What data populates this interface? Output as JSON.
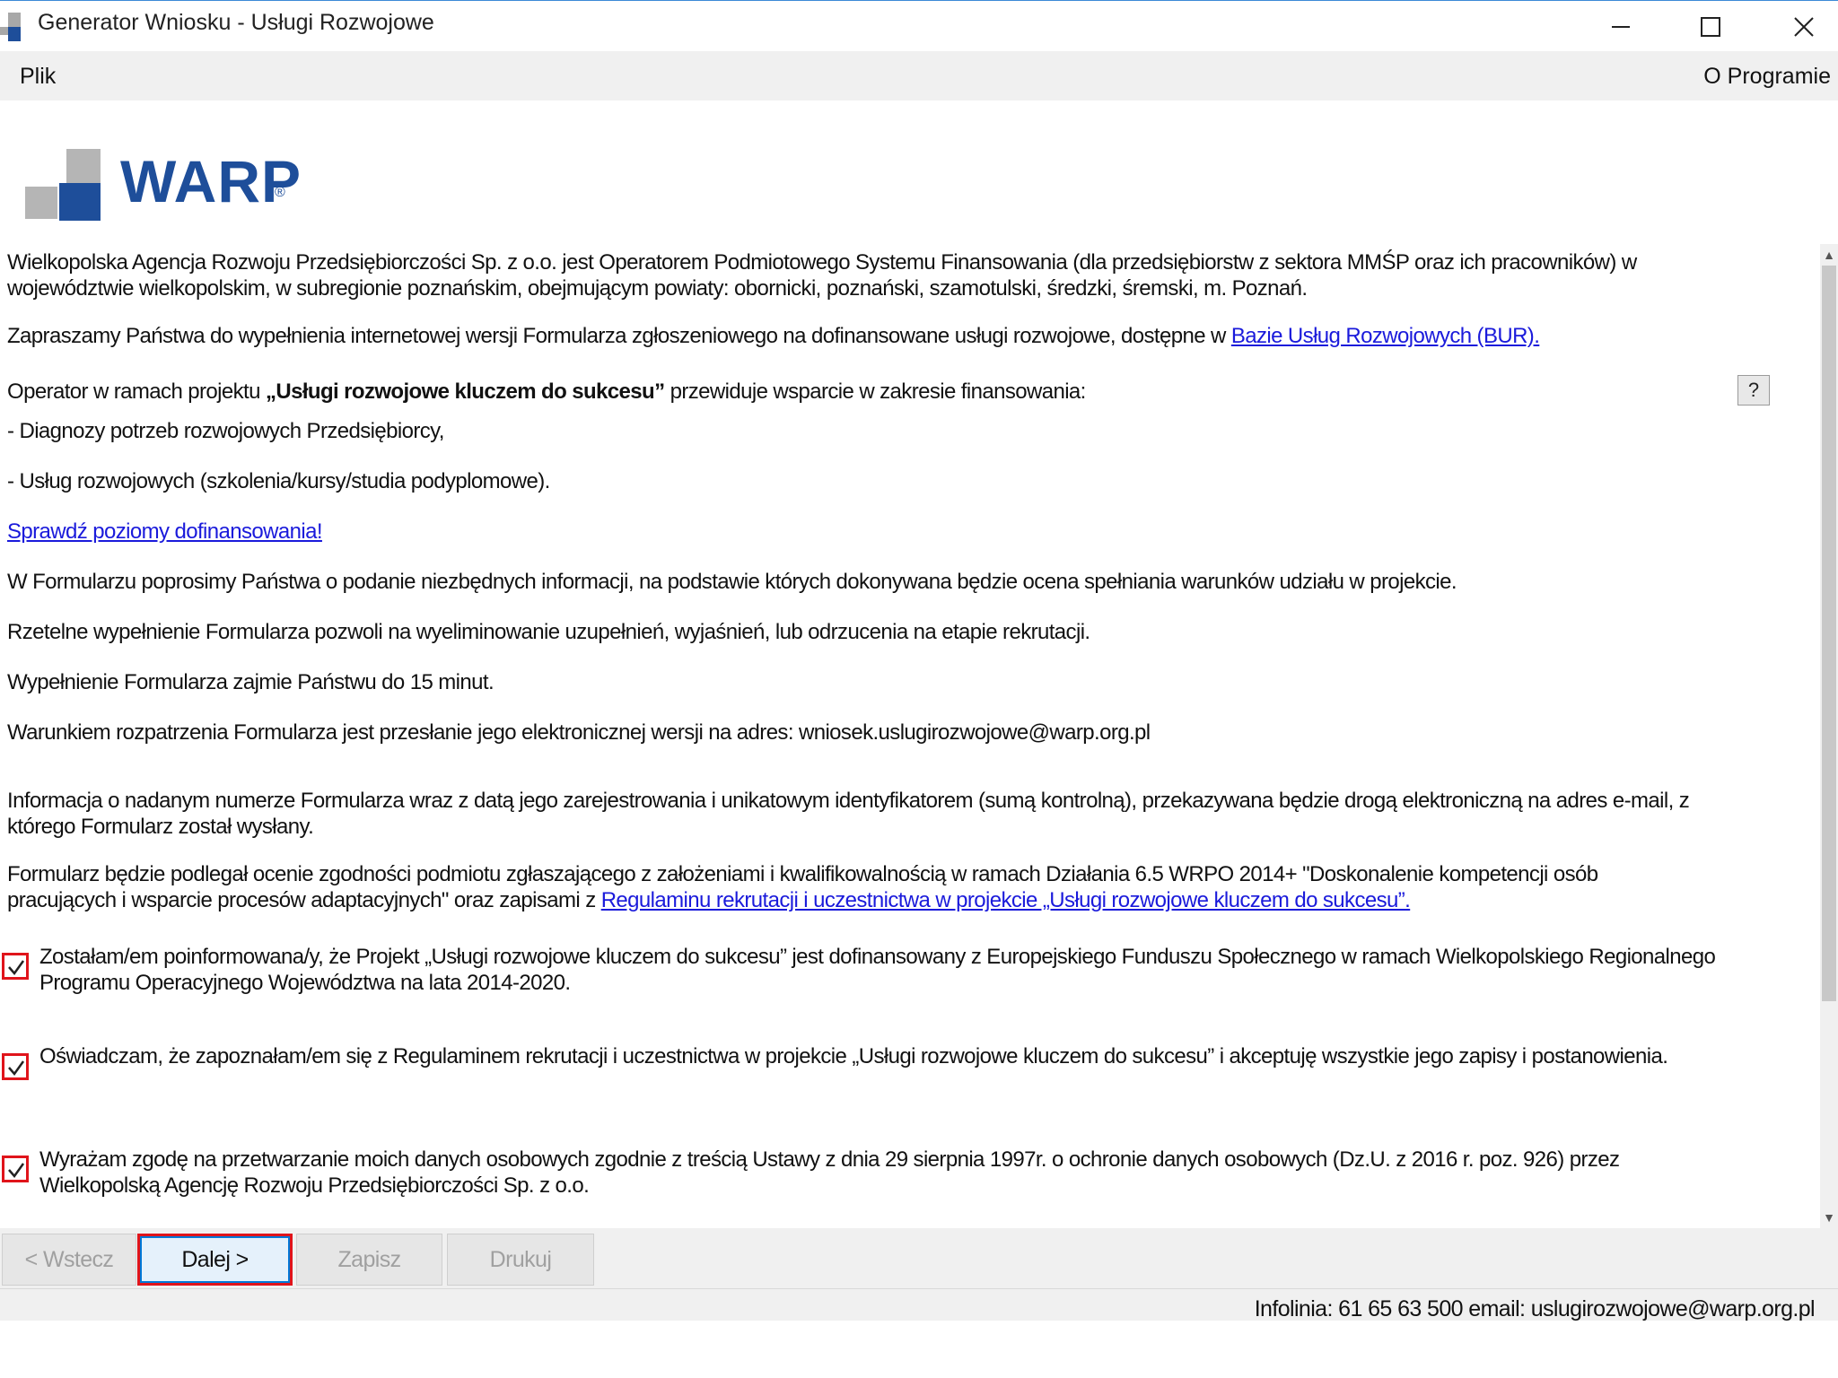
{
  "window": {
    "title": "Generator Wniosku - Usługi Rozwojowe"
  },
  "menu": {
    "file": "Plik",
    "about": "O Programie"
  },
  "logo": {
    "text": "WARP",
    "registered": "®"
  },
  "content": {
    "intro": "Wielkopolska Agencja Rozwoju Przedsiębiorczości Sp. z o.o. jest Operatorem Podmiotowego Systemu Finansowania (dla przedsiębiorstw z sektora MMŚP oraz ich pracowników) w województwie wielkopolskim, w subregionie poznańskim, obejmującym powiaty: obornicki, poznański, szamotulski, średzki, śremski, m. Poznań.",
    "invite_text": "Zapraszamy Państwa do wypełnienia internetowej wersji Formularza zgłoszeniowego na dofinansowane usługi rozwojowe, dostępne w ",
    "invite_link": "Bazie Usług Rozwojowych (BUR).",
    "operator_prefix": "Operator w ramach projektu ",
    "operator_project": "„Usługi rozwojowe kluczem do sukcesu”",
    "operator_suffix": " przewiduje wsparcie w zakresie finansowania:",
    "bullet_1": "- Diagnozy potrzeb rozwojowych Przedsiębiorcy,",
    "bullet_2": "- Usług rozwojowych (szkolenia/kursy/studia podyplomowe).",
    "check_levels_link": "Sprawdź poziomy dofinansowania!",
    "form_info": "W Formularzu poprosimy Państwa o podanie niezbędnych informacji, na podstawie których dokonywana będzie ocena spełniania warunków udziału w projekcie.",
    "reliable": "Rzetelne wypełnienie Formularza pozwoli na wyeliminowanie uzupełnień, wyjaśnień, lub odrzucenia na etapie rekrutacji.",
    "time": "Wypełnienie Formularza zajmie Państwu do 15 minut.",
    "condition": "Warunkiem rozpatrzenia Formularza jest przesłanie jego elektronicznej wersji na adres:  wniosek.uslugirozwojowe@warp.org.pl",
    "number_info": "Informacja o nadanym numerze Formularza wraz z datą jego zarejestrowania i unikatowym identyfikatorem (sumą kontrolną), przekazywana będzie drogą elektroniczną na adres e-mail, z którego Formularz został wysłany.",
    "assessment_text": "Formularz będzie podlegał ocenie zgodności podmiotu zgłaszającego z założeniami i kwalifikowalnością w ramach Działania 6.5 WRPO 2014+ \"Doskonalenie kompetencji osób pracujących i wsparcie procesów adaptacyjnych\" oraz zapisami z ",
    "assessment_link": "Regulaminu rekrutacji i uczestnictwa w projekcie „Usługi rozwojowe kluczem do sukcesu”.",
    "help_button": "?"
  },
  "consents": [
    {
      "checked": true,
      "text": "Zostałam/em poinformowana/y, że Projekt „Usługi rozwojowe kluczem do sukcesu” jest dofinansowany z Europejskiego Funduszu Społecznego w ramach Wielkopolskiego Regionalnego Programu Operacyjnego Województwa na lata 2014-2020."
    },
    {
      "checked": true,
      "text": "Oświadczam, że zapoznałam/em się z Regulaminem rekrutacji i uczestnictwa w projekcie „Usługi rozwojowe kluczem do sukcesu” i akceptuję wszystkie jego zapisy i postanowienia."
    },
    {
      "checked": true,
      "text": "Wyrażam zgodę na przetwarzanie moich danych osobowych zgodnie z treścią Ustawy z dnia 29 sierpnia 1997r. o ochronie danych osobowych (Dz.U. z 2016 r. poz. 926) przez Wielkopolską Agencję Rozwoju Przedsiębiorczości Sp. z o.o."
    }
  ],
  "buttons": {
    "back": "< Wstecz",
    "next": "Dalej >",
    "save": "Zapisz",
    "print": "Drukuj"
  },
  "status": {
    "info": "Infolinia: 61 65 63 500 email: uslugirozwojowe@warp.org.pl"
  },
  "colors": {
    "accent_blue": "#1e4e9a",
    "link": "#1a1adb",
    "highlight_red": "#e0141b",
    "logo_gray": "#b5b5b5"
  },
  "icons": {
    "minimize": "minimize-icon",
    "maximize": "maximize-icon",
    "close": "close-icon",
    "checkmark": "checkmark-icon",
    "help": "help-icon",
    "scroll_up": "scroll-up-arrow-icon",
    "scroll_down": "scroll-down-arrow-icon"
  }
}
